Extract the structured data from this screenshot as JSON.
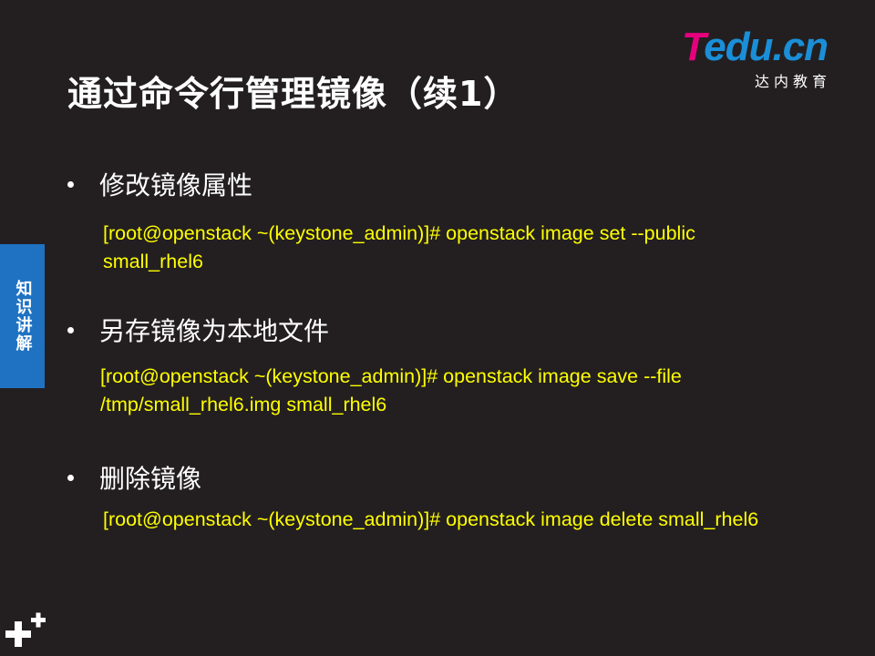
{
  "slide": {
    "title": "通过命令行管理镜像（续1）",
    "logo": {
      "brand_t": "T",
      "brand_rest": "edu.cn",
      "subtitle": "达内教育"
    },
    "side_tab": "知识讲解",
    "sections": [
      {
        "heading": "修改镜像属性",
        "code_line1": "[root@openstack ~(keystone_admin)]# openstack image set --public",
        "code_line2": "small_rhel6"
      },
      {
        "heading": "另存镜像为本地文件",
        "code_line1": "[root@openstack ~(keystone_admin)]# openstack image save --file",
        "code_line2": "/tmp/small_rhel6.img small_rhel6"
      },
      {
        "heading": "删除镜像",
        "code_line1": "[root@openstack ~(keystone_admin)]# openstack image delete small_rhel6"
      }
    ],
    "colors": {
      "background": "#231f20",
      "code": "#ffff00",
      "side_tab": "#1f72c2",
      "logo_pink": "#e6007e",
      "logo_blue": "#1a8fd8"
    },
    "icons": [
      "plus-icon"
    ]
  }
}
